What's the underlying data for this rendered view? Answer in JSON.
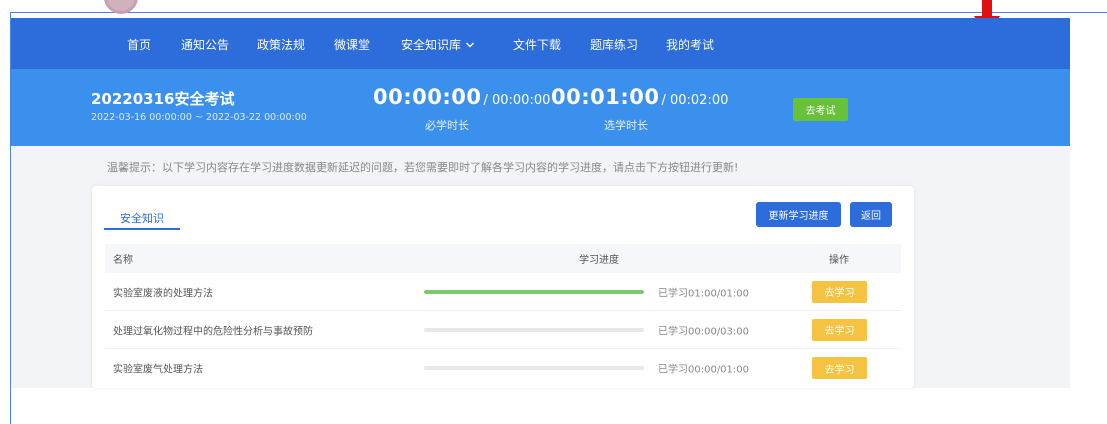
{
  "nav": {
    "items": [
      "首页",
      "通知公告",
      "政策法规",
      "微课堂",
      "安全知识库",
      "文件下载",
      "题库练习",
      "我的考试"
    ]
  },
  "banner": {
    "title": "20220316安全考试",
    "range": "2022-03-16 00:00:00 ~ 2022-03-22 00:00:00",
    "required_time": "00:00:00",
    "required_total": "/ 00:00:00",
    "required_label": "必学时长",
    "optional_time": "00:01:00",
    "optional_total": "/ 00:02:00",
    "optional_label": "选学时长",
    "go_exam": "去考试"
  },
  "tip": "温馨提示：以下学习内容存在学习进度数据更新延迟的问题，若您需要即时了解各学习内容的学习进度，请点击下方按钮进行更新!",
  "card": {
    "tab": "安全知识",
    "update_button": "更新学习进度",
    "back_button": "返回"
  },
  "table": {
    "headers": {
      "name": "名称",
      "progress": "学习进度",
      "action": "操作"
    },
    "rows": [
      {
        "name": "实验室废液的处理方法",
        "progress_fraction": 1.0,
        "progress_text": "已学习01:00/01:00",
        "action": "去学习"
      },
      {
        "name": "处理过氧化物过程中的危险性分析与事故预防",
        "progress_fraction": 0.0,
        "progress_text": "已学习00:00/03:00",
        "action": "去学习"
      },
      {
        "name": "实验室废气处理方法",
        "progress_fraction": 0.0,
        "progress_text": "已学习00:00/01:00",
        "action": "去学习"
      }
    ]
  },
  "colors": {
    "nav_bg": "#2c6cdb",
    "banner_bg": "#3b90ee",
    "go_exam": "#67c23a",
    "study_button": "#f5c242",
    "progress_fill": "#7cc96a",
    "annotation_arrow": "#e01010"
  }
}
